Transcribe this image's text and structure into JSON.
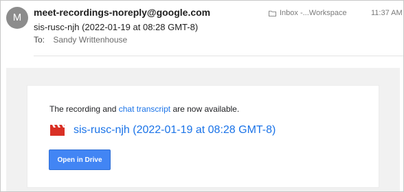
{
  "header": {
    "avatar_letter": "M",
    "sender": "meet-recordings-noreply@google.com",
    "subject": "sis-rusc-njh (2022-01-19 at 08:28 GMT-8)",
    "to_label": "To:",
    "to_name": "Sandy Writtenhouse",
    "folder": "Inbox -...Workspace",
    "time": "11:37 AM"
  },
  "message": {
    "notice_prefix": "The recording and ",
    "notice_link": "chat transcript",
    "notice_suffix": " are now available.",
    "recording_title": "sis-rusc-njh (2022-01-19 at 08:28 GMT-8)",
    "recording_icon": "video-clapper-icon",
    "open_button_label": "Open in Drive"
  },
  "colors": {
    "link": "#1a73e8",
    "button": "#4285f4",
    "clapper": "#d93025",
    "avatar": "#8c8c8c"
  }
}
